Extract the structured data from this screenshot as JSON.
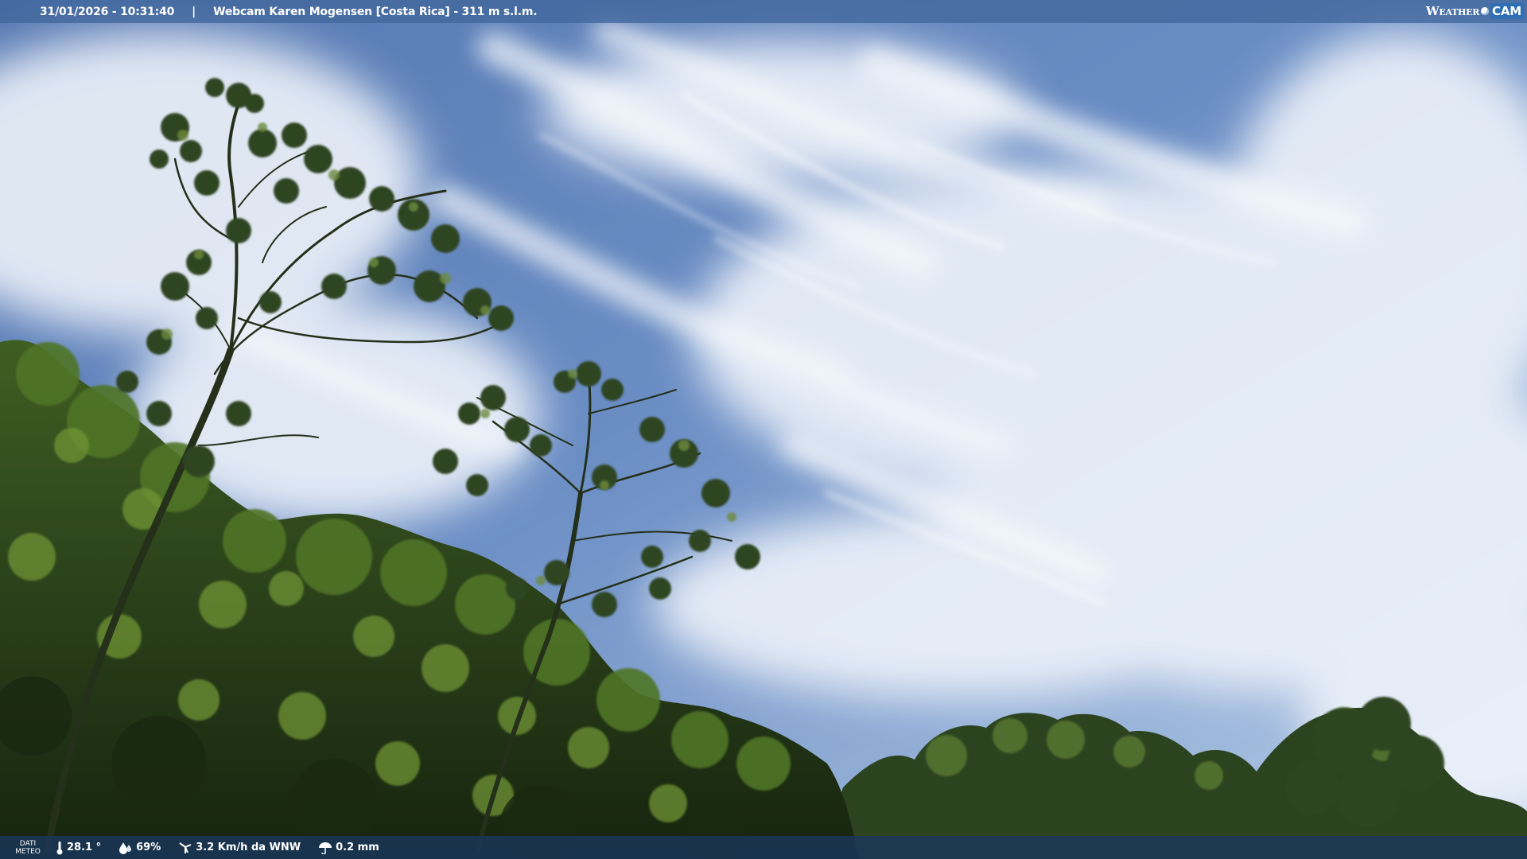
{
  "overlay_top": {
    "timestamp": "31/01/2026 - 10:31:40",
    "separator": "|",
    "title": "Webcam Karen Mogensen [Costa Rica] - 311 m s.l.m."
  },
  "logo": {
    "part1": "Weather",
    "part2": "CAM"
  },
  "overlay_bottom": {
    "label_line1": "DATI",
    "label_line2": "METEO",
    "temperature": "28.1 °",
    "humidity": "69%",
    "wind": "3.2 Km/h da WNW",
    "rain": "0.2 mm"
  },
  "icons": {
    "temperature": "thermometer-icon",
    "humidity": "humidity-drop-icon",
    "wind": "wind-icon",
    "rain": "rain-icon"
  },
  "colors": {
    "sky_top": "#5d82ba",
    "sky_bottom": "#a9c2e2",
    "cloud": "#f4f7fb",
    "foliage_dark": "#1d2d14",
    "foliage_mid": "#3d5a22",
    "foliage_light": "#7b9a3a",
    "bar_top": "#40669c",
    "bar_bottom": "#19375f"
  }
}
